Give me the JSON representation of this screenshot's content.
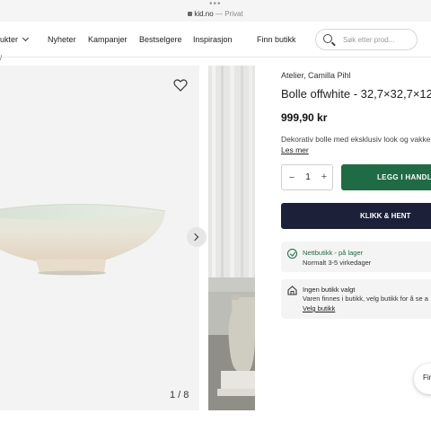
{
  "browser": {
    "host": "kid.no",
    "separator": "—",
    "mode": "Privat"
  },
  "nav": {
    "products_label": "ukter",
    "items": [
      "Nyheter",
      "Kampanjer",
      "Bestselgere",
      "Inspirasjon",
      "Finn butikk"
    ],
    "search_placeholder": "Søk etter prod..."
  },
  "breadcrumb": "/",
  "gallery": {
    "counter": "1 / 8"
  },
  "product": {
    "brand": "Atelier, Camilla Pihl",
    "title": "Bolle offwhite - 32,7×32,7×12",
    "price": "999,90 kr",
    "description": "Dekorativ bolle med eksklusiv look og vakke",
    "read_more": "Les mer",
    "quantity": "1",
    "minus": "−",
    "plus": "+",
    "add_to_cart": "LEGG I HANDLE",
    "click_collect": "KLIKK & HENT"
  },
  "availability": {
    "online_title": "Nettbutikk - på lager",
    "online_sub": "Normalt 3-5 virkedager",
    "store_title": "Ingen butikk valgt",
    "store_text": "Varen finnes i butikk, velg butikk for å se a",
    "store_link": "Velg butikk"
  },
  "floating_button": "Fin",
  "colors": {
    "primary_green": "#1f6b46",
    "dark_navy": "#1c2038"
  }
}
